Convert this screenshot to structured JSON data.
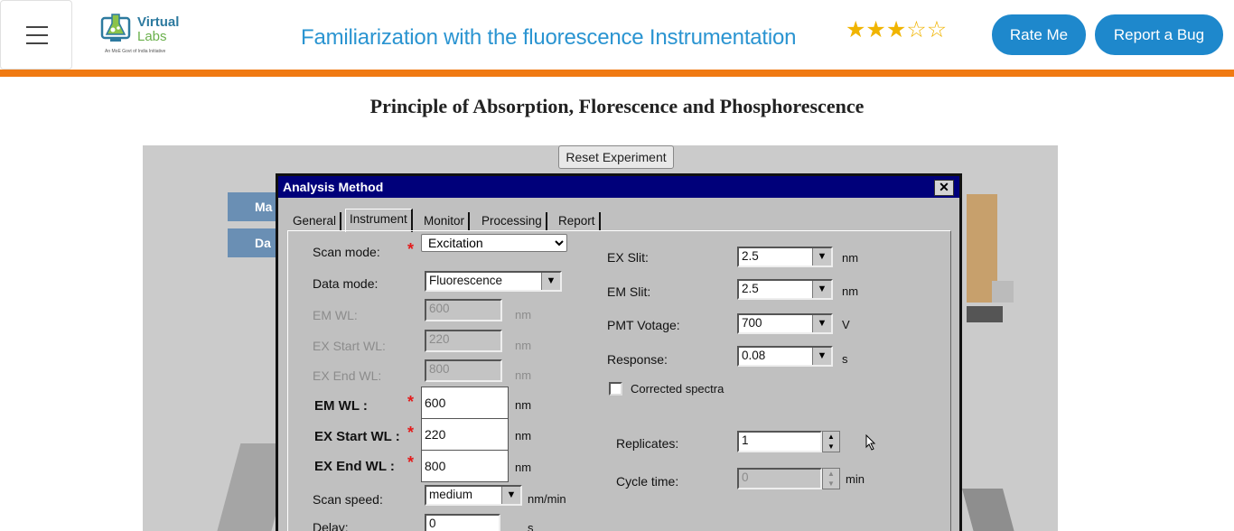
{
  "navbar": {
    "menu_icon": "hamburger-menu-icon",
    "logo": {
      "line1": "Virtual",
      "line2": "Labs",
      "tagline": "An MoE Govt of India Initiative"
    },
    "title": "Familiarization with the fluorescence Instrumentation",
    "rating": {
      "filled": 3,
      "total": 5
    },
    "rate_label": "Rate Me",
    "bug_label": "Report a Bug"
  },
  "page": {
    "heading": "Principle of Absorption, Florescence and Phosphorescence",
    "reset_label": "Reset Experiment",
    "side_buttons": [
      "Ma",
      "Da"
    ]
  },
  "dialog": {
    "title": "Analysis Method",
    "close": "✕",
    "tabs": [
      "General",
      "Instrument",
      "Monitor",
      "Processing",
      "Report"
    ],
    "active_tab": "Instrument",
    "left": {
      "scan_mode": {
        "label": "Scan mode:",
        "value": "Excitation",
        "options": [
          "Excitation"
        ]
      },
      "data_mode": {
        "label": "Data mode:",
        "value": "Fluorescence"
      },
      "em_wl_ro": {
        "label": "EM WL:",
        "value": "600",
        "unit": "nm"
      },
      "ex_start_ro": {
        "label": "EX Start WL:",
        "value": "220",
        "unit": "nm"
      },
      "ex_end_ro": {
        "label": "EX End WL:",
        "value": "800",
        "unit": "nm"
      },
      "em_wl": {
        "label": "EM WL :",
        "value": "600",
        "unit": "nm"
      },
      "ex_start": {
        "label": "EX Start WL :",
        "value": "220",
        "unit": "nm"
      },
      "ex_end": {
        "label": "EX End WL :",
        "value": "800",
        "unit": "nm"
      },
      "scan_speed": {
        "label": "Scan speed:",
        "value": "medium",
        "unit": "nm/min"
      },
      "delay": {
        "label": "Delay:",
        "value": "0",
        "unit": "s"
      },
      "required_mark": "*"
    },
    "right": {
      "ex_slit": {
        "label": "EX Slit:",
        "value": "2.5",
        "unit": "nm"
      },
      "em_slit": {
        "label": "EM Slit:",
        "value": "2.5",
        "unit": "nm"
      },
      "pmt": {
        "label": "PMT Votage:",
        "value": "700",
        "unit": "V"
      },
      "response": {
        "label": "Response:",
        "value": "0.08",
        "unit": "s"
      },
      "corrected": {
        "label": "Corrected spectra",
        "checked": false
      },
      "replicates": {
        "label": "Replicates:",
        "value": "1"
      },
      "cycle": {
        "label": "Cycle time:",
        "value": "0",
        "unit": "min"
      }
    }
  }
}
